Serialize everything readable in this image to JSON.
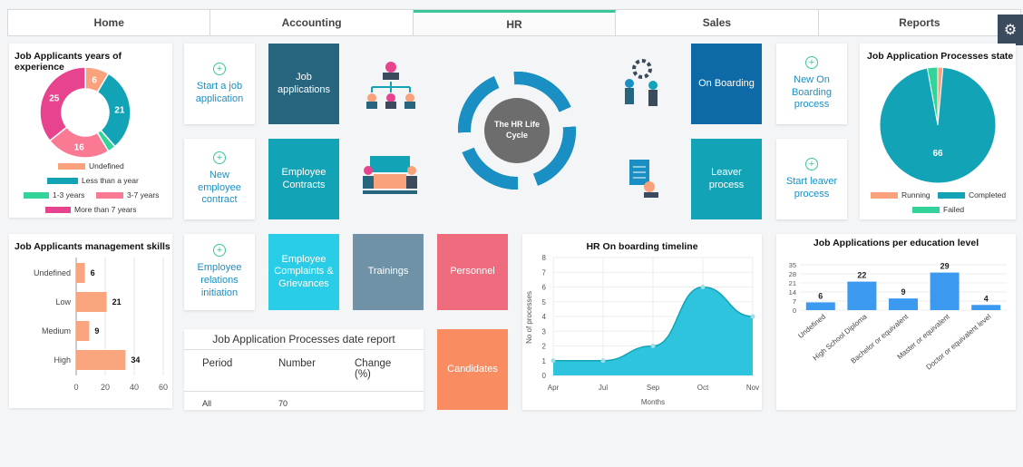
{
  "tabs": [
    "Home",
    "Accounting",
    "HR",
    "Sales",
    "Reports"
  ],
  "settings_icon": "gear-icon",
  "experience": {
    "title": "Job Applicants years of experience",
    "labels": [
      "6",
      "21",
      "16",
      "25"
    ],
    "legend": [
      "Undefined",
      "Less than a year",
      "1-3 years",
      "3-7 years",
      "More than 7 years"
    ],
    "colors": [
      "#f9a27c",
      "#13a3b6",
      "#33d39a",
      "#fa7a94",
      "#e8438f"
    ],
    "chart_data": {
      "type": "pie",
      "categories": [
        "Undefined",
        "Less than a year",
        "1-3 years",
        "3-7 years",
        "More than 7 years"
      ],
      "values": [
        6,
        21,
        2,
        16,
        25
      ]
    }
  },
  "tiles": {
    "start_job": "Start a job application",
    "job_apps": "Job applications",
    "new_emp": "New employee contract",
    "emp_contracts": "Employee Contracts",
    "relations": "Employee relations initiation",
    "complaints": "Employee Complaints & Grievances",
    "trainings": "Trainings",
    "personnel": "Personnel",
    "candidates": "Candidates",
    "onboarding": "On Boarding",
    "new_onboarding": "New On Boarding process",
    "leaver": "Leaver process",
    "start_leaver": "Start leaver process",
    "lifecycle": "The HR Life Cycle"
  },
  "skills": {
    "title": "Job Applicants management skills",
    "chart_data": {
      "type": "bar",
      "categories": [
        "Undefined",
        "Low",
        "Medium",
        "High"
      ],
      "values": [
        6,
        21,
        9,
        34
      ],
      "xlim": [
        0,
        60
      ],
      "xticks": [
        "0",
        "20",
        "40",
        "60"
      ]
    }
  },
  "report": {
    "title": "Job Application Processes date report",
    "headers": [
      "Period",
      "Number",
      "Change (%)"
    ],
    "row": [
      "All",
      "70",
      ""
    ]
  },
  "timeline": {
    "title": "HR On boarding timeline",
    "xlabel": "Months",
    "ylabel": "No of processes",
    "chart_data": {
      "type": "area",
      "x": [
        "Apr",
        "Jul",
        "Sep",
        "Oct",
        "Nov"
      ],
      "values": [
        1,
        1,
        2,
        6,
        4
      ],
      "ylim": [
        0,
        8
      ]
    }
  },
  "state": {
    "title": "Job Application Processes state",
    "label": "66",
    "legend": [
      "Running",
      "Completed",
      "Failed"
    ],
    "colors": [
      "#f9a27c",
      "#13a3b6",
      "#33d39a"
    ],
    "chart_data": {
      "type": "pie",
      "categories": [
        "Running",
        "Completed",
        "Failed"
      ],
      "values": [
        1,
        66,
        2
      ]
    }
  },
  "education": {
    "title": "Job Applications per education level",
    "yticks": [
      "35",
      "28",
      "21",
      "14",
      "7",
      "0"
    ],
    "chart_data": {
      "type": "bar",
      "categories": [
        "Undefined",
        "High School Diploma",
        "Bachelor or equivalent",
        "Master or equivalent",
        "Doctor or equivalent level"
      ],
      "values": [
        6,
        22,
        9,
        29,
        4
      ],
      "ylim": [
        0,
        35
      ]
    }
  }
}
